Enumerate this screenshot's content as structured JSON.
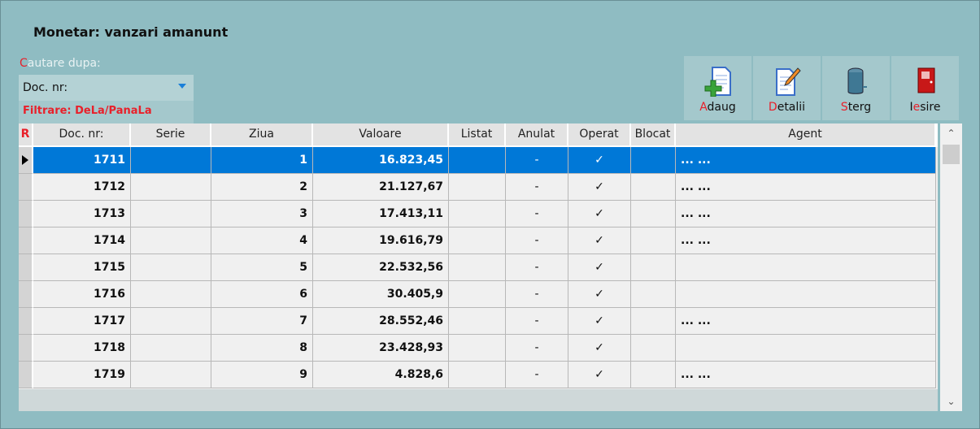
{
  "title": "Monetar: vanzari amanunt",
  "search": {
    "label_first": "C",
    "label_rest": "autare dupa:",
    "value": "Doc. nr:",
    "filter": "Filtrare: DeLa/PanaLa"
  },
  "toolbar": [
    {
      "hot": "A",
      "rest": "daug",
      "pre": "",
      "icon": "add-document-icon"
    },
    {
      "hot": "D",
      "rest": "etalii",
      "pre": "",
      "icon": "edit-document-icon"
    },
    {
      "hot": "S",
      "rest": "terg",
      "pre": "",
      "icon": "trash-can-icon"
    },
    {
      "pre": "I",
      "hot": "e",
      "rest": "sire",
      "icon": "exit-door-icon"
    }
  ],
  "grid": {
    "corner": "R",
    "columns": [
      "Doc. nr:",
      "Serie",
      "Ziua",
      "Valoare",
      "Listat",
      "Anulat",
      "Operat",
      "Blocat",
      "Agent"
    ],
    "rows": [
      {
        "doc": "1711",
        "serie": "",
        "ziua": "1",
        "valoare": "16.823,45",
        "listat": "",
        "anulat": "-",
        "operat": "✓",
        "blocat": "",
        "agent": "... ..."
      },
      {
        "doc": "1712",
        "serie": "",
        "ziua": "2",
        "valoare": "21.127,67",
        "listat": "",
        "anulat": "-",
        "operat": "✓",
        "blocat": "",
        "agent": "... ..."
      },
      {
        "doc": "1713",
        "serie": "",
        "ziua": "3",
        "valoare": "17.413,11",
        "listat": "",
        "anulat": "-",
        "operat": "✓",
        "blocat": "",
        "agent": "... ..."
      },
      {
        "doc": "1714",
        "serie": "",
        "ziua": "4",
        "valoare": "19.616,79",
        "listat": "",
        "anulat": "-",
        "operat": "✓",
        "blocat": "",
        "agent": "... ..."
      },
      {
        "doc": "1715",
        "serie": "",
        "ziua": "5",
        "valoare": "22.532,56",
        "listat": "",
        "anulat": "-",
        "operat": "✓",
        "blocat": "",
        "agent": ""
      },
      {
        "doc": "1716",
        "serie": "",
        "ziua": "6",
        "valoare": "30.405,9",
        "listat": "",
        "anulat": "-",
        "operat": "✓",
        "blocat": "",
        "agent": ""
      },
      {
        "doc": "1717",
        "serie": "",
        "ziua": "7",
        "valoare": "28.552,46",
        "listat": "",
        "anulat": "-",
        "operat": "✓",
        "blocat": "",
        "agent": "... ..."
      },
      {
        "doc": "1718",
        "serie": "",
        "ziua": "8",
        "valoare": "23.428,93",
        "listat": "",
        "anulat": "-",
        "operat": "✓",
        "blocat": "",
        "agent": ""
      },
      {
        "doc": "1719",
        "serie": "",
        "ziua": "9",
        "valoare": "4.828,6",
        "listat": "",
        "anulat": "-",
        "operat": "✓",
        "blocat": "",
        "agent": "... ..."
      }
    ]
  }
}
